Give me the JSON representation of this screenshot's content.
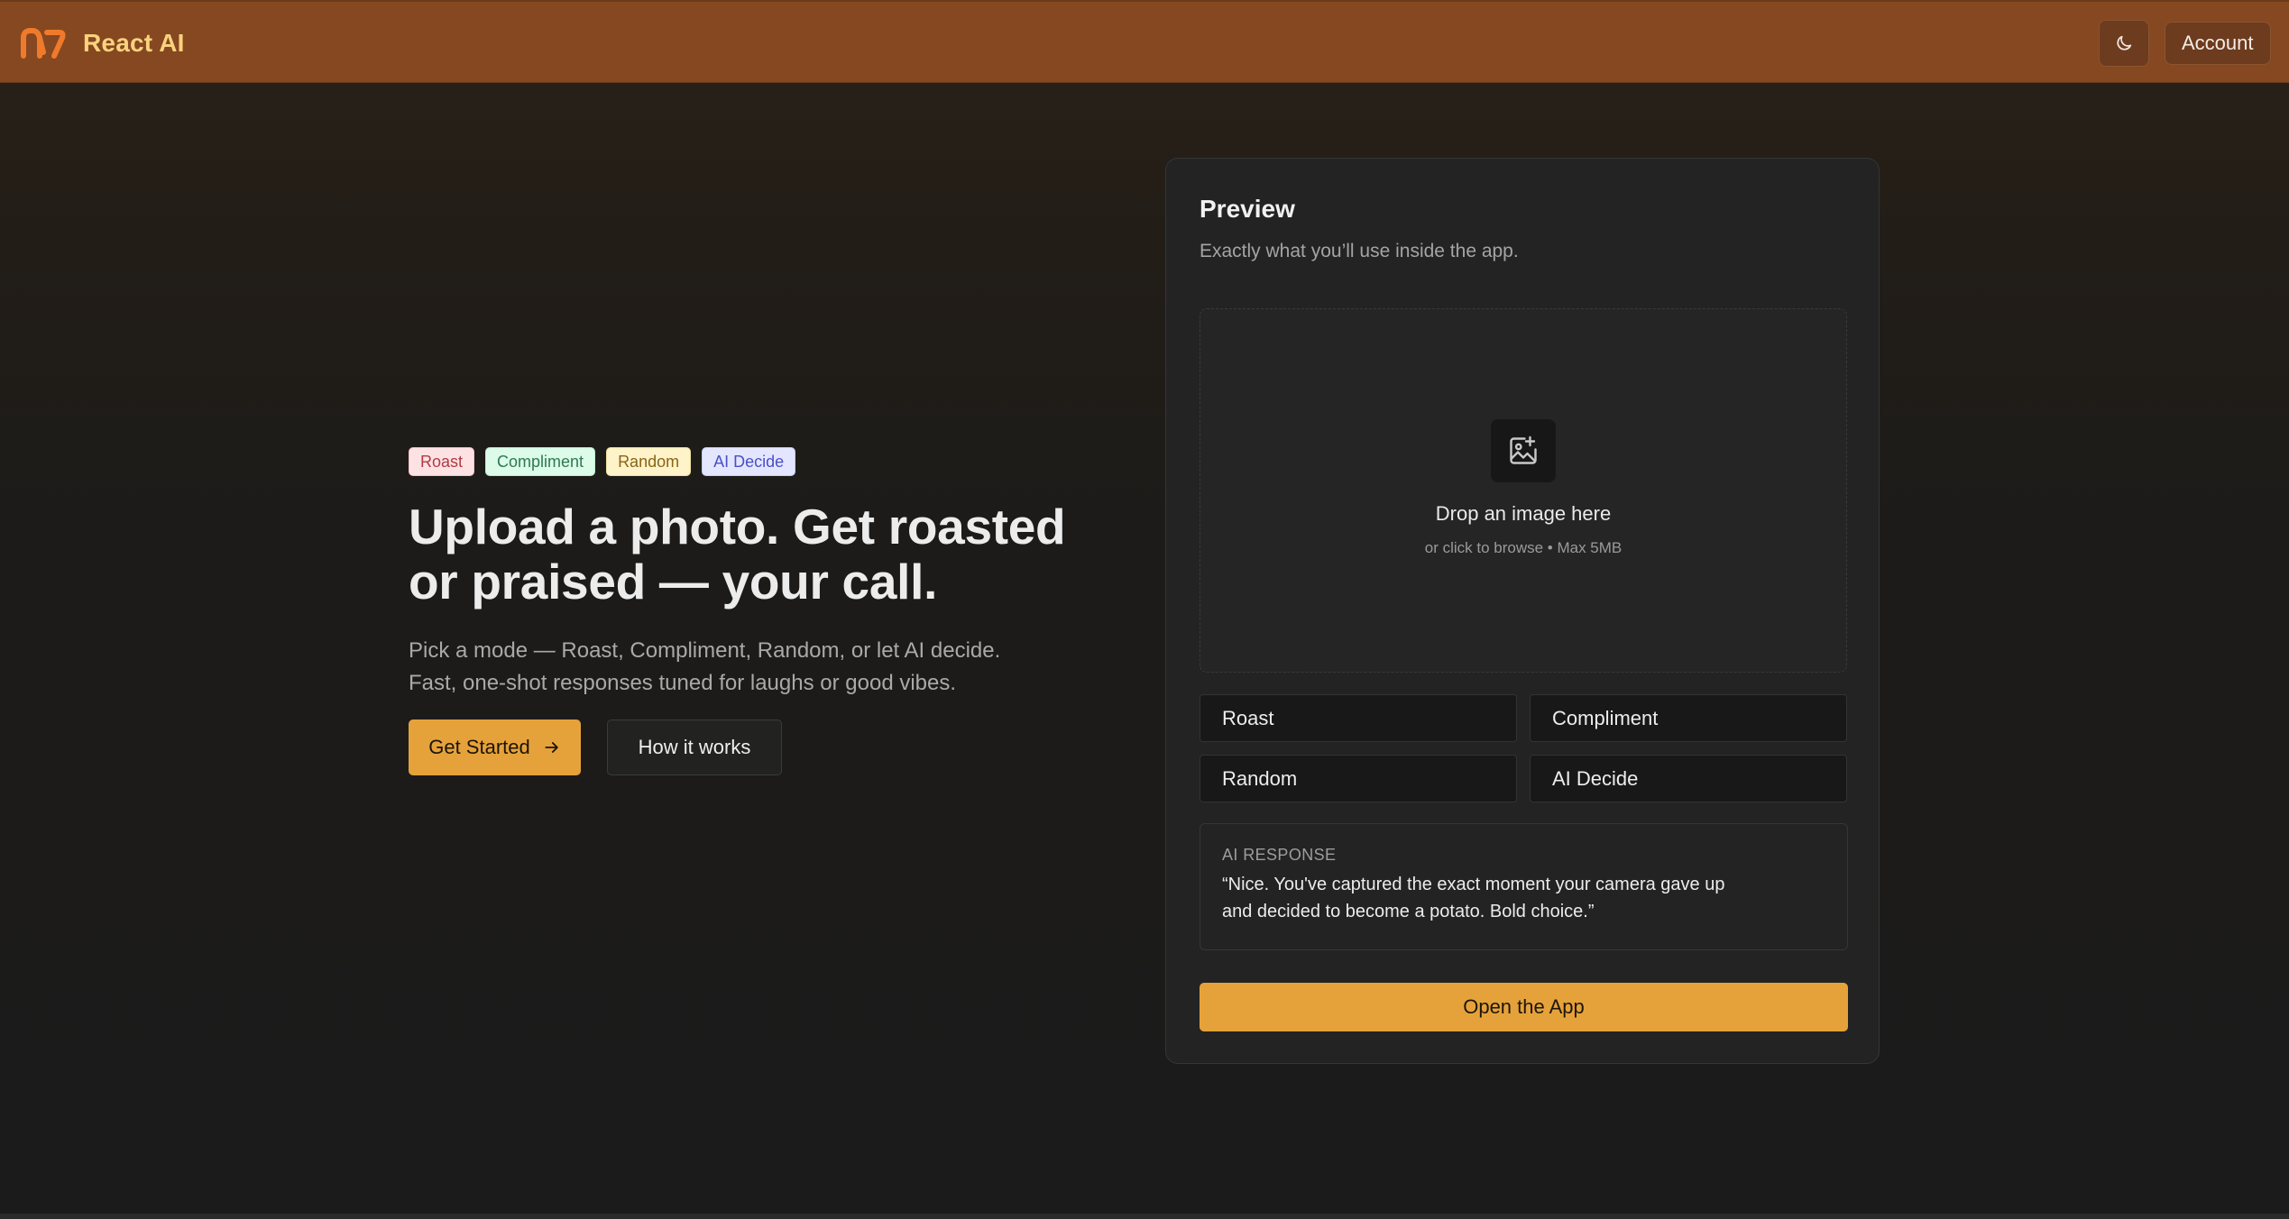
{
  "app": {
    "name": "React AI"
  },
  "header": {
    "theme_icon": "moon-icon",
    "account_label": "Account"
  },
  "hero": {
    "tags": [
      "Roast",
      "Compliment",
      "Random",
      "AI Decide"
    ],
    "title": "Upload a photo. Get roasted or praised — your call.",
    "subtitle_line1": "Pick a mode — Roast, Compliment, Random, or let AI decide.",
    "subtitle_line2": "Fast, one-shot responses tuned for laughs or good vibes.",
    "primary_cta": "Get Started",
    "primary_cta_icon": "arrow-right-icon",
    "secondary_cta": "How it works"
  },
  "preview": {
    "title": "Preview",
    "subtitle": "Exactly what you’ll use inside the app.",
    "dropzone": {
      "icon": "image-plus-icon",
      "title": "Drop an image here",
      "hint": "or click to browse • Max 5MB"
    },
    "modes": [
      "Roast",
      "Compliment",
      "Random",
      "AI Decide"
    ],
    "response_label": "AI RESPONSE",
    "response_text": "“Nice. You've captured the exact moment your camera gave up and decided to become a potato. Bold choice.”",
    "open_button": "Open the App"
  },
  "colors": {
    "header_bg": "#864820",
    "brand_text": "#f9d27e",
    "accent": "#e6a23a",
    "card_bg": "#232323",
    "page_bg": "#1b1b1b"
  }
}
